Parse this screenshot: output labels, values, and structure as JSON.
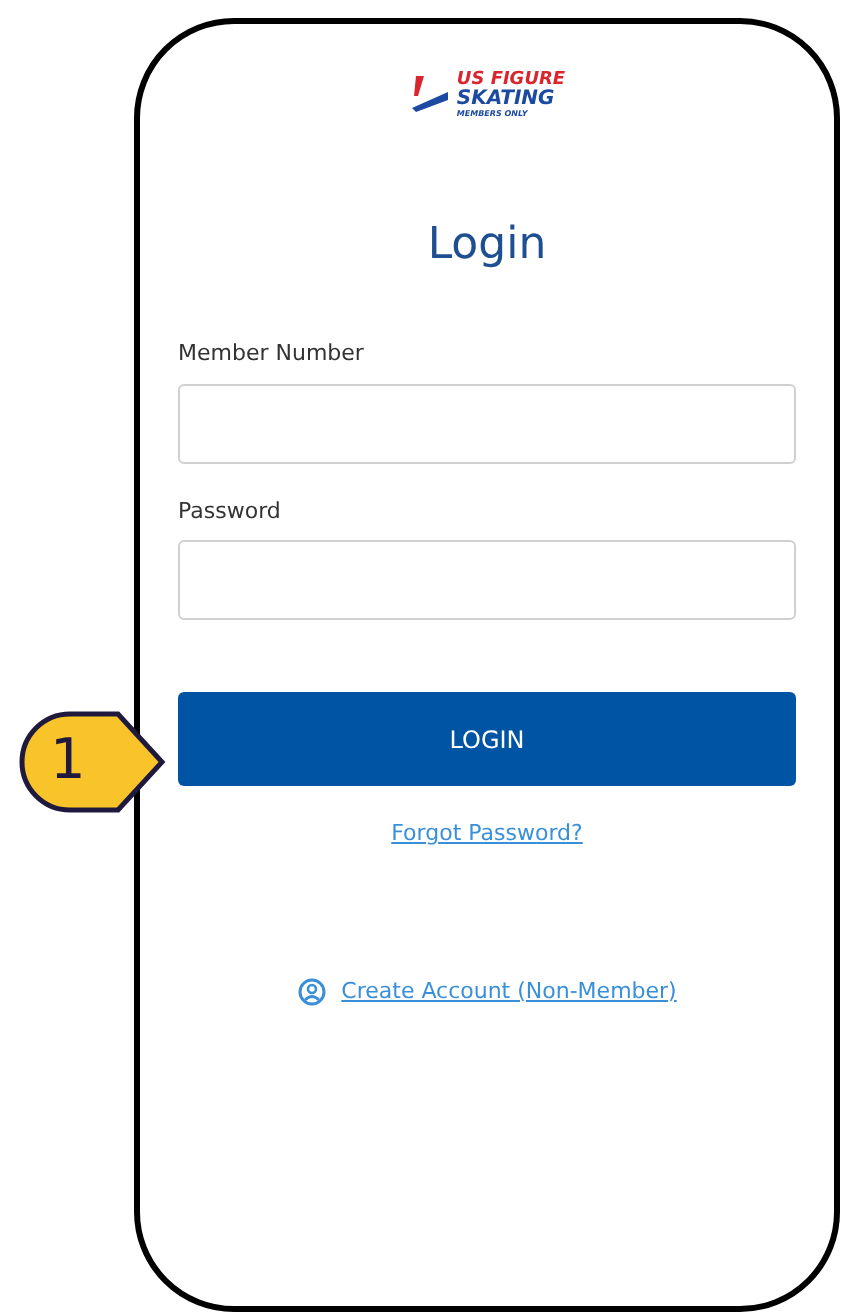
{
  "logo": {
    "line_1": "US FIGURE",
    "line_2": "SKATING",
    "line_3": "MEMBERS ONLY"
  },
  "title": "Login",
  "fields": [
    {
      "label": "Member Number"
    },
    {
      "label": "Password"
    }
  ],
  "login_button": "LOGIN",
  "forgot_link": "Forgot Password?",
  "create_account_link": "Create Account (Non-Member)",
  "callout": "1"
}
